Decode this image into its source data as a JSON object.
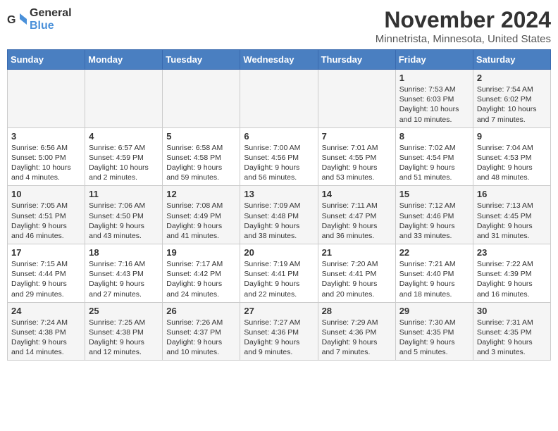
{
  "header": {
    "logo_general": "General",
    "logo_blue": "Blue",
    "month_title": "November 2024",
    "location": "Minnetrista, Minnesota, United States"
  },
  "days_of_week": [
    "Sunday",
    "Monday",
    "Tuesday",
    "Wednesday",
    "Thursday",
    "Friday",
    "Saturday"
  ],
  "weeks": [
    [
      {
        "day": "",
        "info": ""
      },
      {
        "day": "",
        "info": ""
      },
      {
        "day": "",
        "info": ""
      },
      {
        "day": "",
        "info": ""
      },
      {
        "day": "",
        "info": ""
      },
      {
        "day": "1",
        "info": "Sunrise: 7:53 AM\nSunset: 6:03 PM\nDaylight: 10 hours and 10 minutes."
      },
      {
        "day": "2",
        "info": "Sunrise: 7:54 AM\nSunset: 6:02 PM\nDaylight: 10 hours and 7 minutes."
      }
    ],
    [
      {
        "day": "3",
        "info": "Sunrise: 6:56 AM\nSunset: 5:00 PM\nDaylight: 10 hours and 4 minutes."
      },
      {
        "day": "4",
        "info": "Sunrise: 6:57 AM\nSunset: 4:59 PM\nDaylight: 10 hours and 2 minutes."
      },
      {
        "day": "5",
        "info": "Sunrise: 6:58 AM\nSunset: 4:58 PM\nDaylight: 9 hours and 59 minutes."
      },
      {
        "day": "6",
        "info": "Sunrise: 7:00 AM\nSunset: 4:56 PM\nDaylight: 9 hours and 56 minutes."
      },
      {
        "day": "7",
        "info": "Sunrise: 7:01 AM\nSunset: 4:55 PM\nDaylight: 9 hours and 53 minutes."
      },
      {
        "day": "8",
        "info": "Sunrise: 7:02 AM\nSunset: 4:54 PM\nDaylight: 9 hours and 51 minutes."
      },
      {
        "day": "9",
        "info": "Sunrise: 7:04 AM\nSunset: 4:53 PM\nDaylight: 9 hours and 48 minutes."
      }
    ],
    [
      {
        "day": "10",
        "info": "Sunrise: 7:05 AM\nSunset: 4:51 PM\nDaylight: 9 hours and 46 minutes."
      },
      {
        "day": "11",
        "info": "Sunrise: 7:06 AM\nSunset: 4:50 PM\nDaylight: 9 hours and 43 minutes."
      },
      {
        "day": "12",
        "info": "Sunrise: 7:08 AM\nSunset: 4:49 PM\nDaylight: 9 hours and 41 minutes."
      },
      {
        "day": "13",
        "info": "Sunrise: 7:09 AM\nSunset: 4:48 PM\nDaylight: 9 hours and 38 minutes."
      },
      {
        "day": "14",
        "info": "Sunrise: 7:11 AM\nSunset: 4:47 PM\nDaylight: 9 hours and 36 minutes."
      },
      {
        "day": "15",
        "info": "Sunrise: 7:12 AM\nSunset: 4:46 PM\nDaylight: 9 hours and 33 minutes."
      },
      {
        "day": "16",
        "info": "Sunrise: 7:13 AM\nSunset: 4:45 PM\nDaylight: 9 hours and 31 minutes."
      }
    ],
    [
      {
        "day": "17",
        "info": "Sunrise: 7:15 AM\nSunset: 4:44 PM\nDaylight: 9 hours and 29 minutes."
      },
      {
        "day": "18",
        "info": "Sunrise: 7:16 AM\nSunset: 4:43 PM\nDaylight: 9 hours and 27 minutes."
      },
      {
        "day": "19",
        "info": "Sunrise: 7:17 AM\nSunset: 4:42 PM\nDaylight: 9 hours and 24 minutes."
      },
      {
        "day": "20",
        "info": "Sunrise: 7:19 AM\nSunset: 4:41 PM\nDaylight: 9 hours and 22 minutes."
      },
      {
        "day": "21",
        "info": "Sunrise: 7:20 AM\nSunset: 4:41 PM\nDaylight: 9 hours and 20 minutes."
      },
      {
        "day": "22",
        "info": "Sunrise: 7:21 AM\nSunset: 4:40 PM\nDaylight: 9 hours and 18 minutes."
      },
      {
        "day": "23",
        "info": "Sunrise: 7:22 AM\nSunset: 4:39 PM\nDaylight: 9 hours and 16 minutes."
      }
    ],
    [
      {
        "day": "24",
        "info": "Sunrise: 7:24 AM\nSunset: 4:38 PM\nDaylight: 9 hours and 14 minutes."
      },
      {
        "day": "25",
        "info": "Sunrise: 7:25 AM\nSunset: 4:38 PM\nDaylight: 9 hours and 12 minutes."
      },
      {
        "day": "26",
        "info": "Sunrise: 7:26 AM\nSunset: 4:37 PM\nDaylight: 9 hours and 10 minutes."
      },
      {
        "day": "27",
        "info": "Sunrise: 7:27 AM\nSunset: 4:36 PM\nDaylight: 9 hours and 9 minutes."
      },
      {
        "day": "28",
        "info": "Sunrise: 7:29 AM\nSunset: 4:36 PM\nDaylight: 9 hours and 7 minutes."
      },
      {
        "day": "29",
        "info": "Sunrise: 7:30 AM\nSunset: 4:35 PM\nDaylight: 9 hours and 5 minutes."
      },
      {
        "day": "30",
        "info": "Sunrise: 7:31 AM\nSunset: 4:35 PM\nDaylight: 9 hours and 3 minutes."
      }
    ]
  ]
}
